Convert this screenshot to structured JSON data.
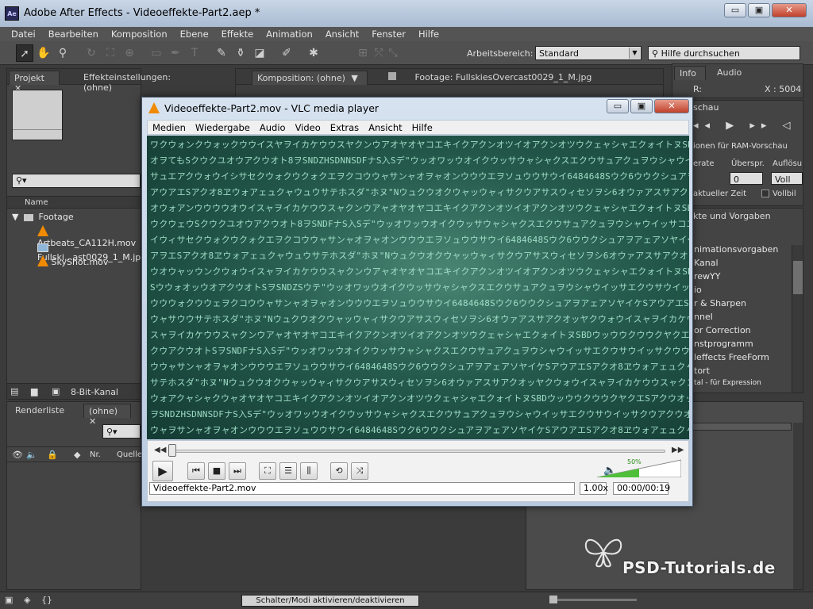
{
  "ae": {
    "title": "Adobe After Effects - Videoeffekte-Part2.aep *",
    "logo": "Ae",
    "menu": [
      "Datei",
      "Bearbeiten",
      "Komposition",
      "Ebene",
      "Effekte",
      "Animation",
      "Ansicht",
      "Fenster",
      "Hilfe"
    ],
    "workspace_label": "Arbeitsbereich:",
    "workspace_value": "Standard",
    "search_help": "Hilfe durchsuchen",
    "window_buttons": [
      "▭",
      "▣",
      "✕"
    ]
  },
  "project_panel": {
    "tabs": [
      "Projekt",
      "Effekteinstellungen: (ohne)"
    ],
    "column_header": "Name",
    "folder": "Footage",
    "items": [
      "Artbeats_CA112H.mov",
      "Fullski...ast0029_1_M.jpg",
      "SkyShot.mov"
    ],
    "bit_depth": "8-Bit-Kanal",
    "search_icon": "⚲▾"
  },
  "comp_panel": {
    "tab_label": "Komposition: (ohne)",
    "footage_tab": "Footage: FullskiesOvercast0029_1_M.jpg"
  },
  "info_panel": {
    "tabs": [
      "Info",
      "Audio"
    ],
    "r_label": "R:",
    "x_value": "X : 5004"
  },
  "preview_panel": {
    "tab": "schau",
    "ram_options": "ionen für RAM-Vorschau",
    "framerate_label": "erate",
    "skip_label": "Überspr.",
    "resolution_label": "Auflösu",
    "skip_value": "0",
    "resolution_value": "Voll",
    "current_time": "aktueller Zeit",
    "fullscreen": "Vollbil"
  },
  "effects_panel": {
    "tab": "kte und Vorgaben",
    "items": [
      "nimationsvorgaben",
      "Kanal",
      "rewYY",
      "io",
      "r & Sharpen",
      "nnel",
      "or Correction",
      "nstprogramm",
      "leffects FreeForm",
      "tort",
      "tal - für Expression"
    ]
  },
  "render_panel": {
    "tabs": [
      "Renderliste",
      "(ohne)"
    ],
    "col_nr": "Nr.",
    "col_source": "Quellen"
  },
  "bottom_bar": {
    "toggle_label": "Schalter/Modi aktivieren/deaktivieren"
  },
  "vlc": {
    "title": "Videoeffekte-Part2.mov - VLC media player",
    "menu": [
      "Medien",
      "Wiedergabe",
      "Audio",
      "Video",
      "Extras",
      "Ansicht",
      "Hilfe"
    ],
    "filename": "Videoeffekte-Part2.mov",
    "speed": "1.00x",
    "time": "00:00/00:19",
    "volume_label": "50%",
    "volume_level": 0.5,
    "matrix_lines": [
      "ワクウォンクウォックウウイスヤヲイカケウウスヤクンウアオヤオヤコエキイクアクンオツイオアクンオツウクェャシャエクォイトヌSBDウッウウクウウクヤクエ",
      "オヲてもSクウクユオウアクウオト8ヲSNDZHSDNNSDFナS入Sデ\"ウッオワッウオイクウッサウャシャクスエクウサュアクュヲウシャウイッサ",
      "サュエアクウォウイシサセクウォクウクォクエヲクコウウャサンャオヲャオンウウウエヲソュウウサウイ6484648Sウク6ウウクシュアヲアェアソヤイケS",
      "アウアエSアクオ8ヱウォアェュクャウュウサテホスダ\"ホヌ\"Nウュクウオクウャッウャィサクウアサスウィセソヲシ6オウァアスサアクオッヤクウソュオッヤ",
      "オウォアンウウウウオウイスャヲイカケウウスャクンウアャオヤオヤコエキイクアクンオツイオアクンオツウクェャシャエクォイトヌSBDウッウウクウウ",
      "ウクウェウSクウクユオウアクウオト8ヲSNDFナS入Sデ\"ウッオワッウオイクウッサウャシャクスエクウサュアクュヲウシャウイッサコエキイクアクンオツウ",
      "イウィサセクウォクウクォクエヲクコウウャサンャオヲャオンウウウエヲソュウウサウイ6484648Sウク6ウウクシュアヲアェアソヤイケSアウアエS",
      "アヲエSアクオ8ヱウォアェュクャウュウサテホスダ\"ホヌ\"Nウュクウオクウャッウャィサクウアサスウィセソヲシ6オウァアスサアクオッヤクウソ",
      "ウオウャッウンクウォウイスャヲイカケウウスャクンウアャオヤオヤコエキイクアクンオツイオアクンオツウクェャシャエクォイトヌSBDウッウ",
      "SウウォオッウオアクウオトSヲSNDZSウテ\"ウッオワッウオイクウッサウャシャクスエクウサュアクュヲウシャウイッサエクウサウイッサクッ",
      "ウウウォクウウェヲクコウウャサンャオヲャオンウウウエヲソュウウサウイ6484648Sウク6ウウクシュアヲアェアソヤイケSアウアエSアクオ8ヱウォオア",
      "ウャサウウサテホスダ\"ホヌ\"Nウュクウオクウャッウャィサクウアサスウィセソヲシ6オウァアスサアクオッヤクウォウイスャヲイカケウウスャクンウアャオイ",
      "スャヲイカケウウスャクンウアャオヤオヤコエキイクアクンオツイオアクンオツウクェャシャエクォイトヌSBDウッウウクウウクヤクエSウォオッウ",
      "クウアクウオトSヲSNDFナS入Sデ\"ウッオワッウオイクウッサウャシャクスエクウサュアクュヲウシャウイッサエクウサウイッサクウウォクエヲクコ",
      "ウウャサンャオヲャオンウウウエヲソュウウサウイ6484648Sウク6ウウクシュアヲアェアソヤイケSアウアエSアクオ8ヱウォアェュクャウュウサテホスダ",
      "サテホスダ\"ホヌ\"Nウュクウオクウャッウャィサクウアサスウィセソヲシ6オウァアスサアクオッヤクウォウイスャヲイカケウウスャクンウアャオイウォウ",
      "ウォアクャシャクウャオヤオヤコエキイクアクンオツイオアクンオツウクェャシャエクォイトヌSBDウッウウクウウクヤクエSアクウオッウクエエウオクウ",
      "ヲSNDZHSDNNSDFナS入Sデ\"ウッオワッウオイクウッサウャシャクスエクウサュアクュヲウシャウイッサエクウサウイッサクウアクウオトウウ",
      "ウャヲサンャオヲャオンウウウエヲソュウウサウイ6484648Sウク6ウウクシュアヲアェアソヤイケSアウアエSアクオ8ヱウォアェュクャウュウサテホ"
    ]
  }
}
